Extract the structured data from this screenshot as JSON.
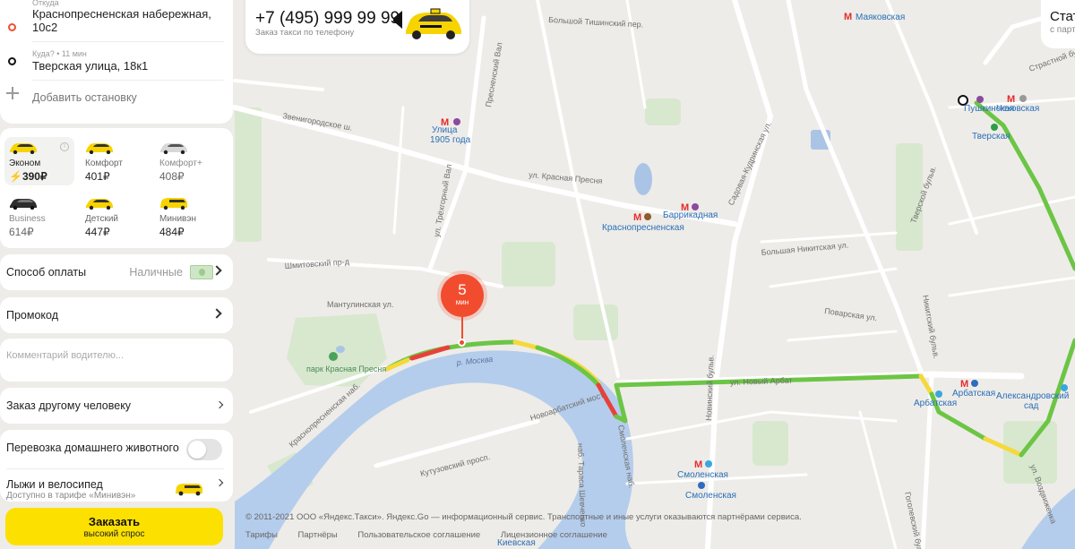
{
  "route": {
    "from_hint": "Откуда",
    "from_address_line1": "Краснопресненская набережная,",
    "from_address_line2": "10с2",
    "to_hint": "Куда? • 11 мин",
    "to_address": "Тверская улица, 18к1",
    "add_stop": "Добавить остановку"
  },
  "tariffs": [
    {
      "name": "Эконом",
      "price": "390₽",
      "surge": "⚡",
      "selected": true
    },
    {
      "name": "Комфорт",
      "price": "401₽",
      "selected": false
    },
    {
      "name": "Комфорт+",
      "price": "408₽",
      "selected": false
    },
    {
      "name": "Business",
      "price": "614₽",
      "selected": false
    },
    {
      "name": "Детский",
      "price": "447₽",
      "selected": false
    },
    {
      "name": "Минивэн",
      "price": "484₽",
      "selected": false
    }
  ],
  "options": {
    "payment_label": "Способ оплаты",
    "payment_value": "Наличные",
    "promo_label": "Промокод",
    "comment_placeholder": "Комментарий водителю...",
    "other_person_label": "Заказ другому человеку",
    "pet_label": "Перевозка домашнего животного",
    "ski_label": "Лыжи и велосипед",
    "ski_sub": "Доступно в тарифе «Минивэн»"
  },
  "order": {
    "label": "Заказать",
    "sub": "высокий спрос"
  },
  "phone_card": {
    "number": "+7 (495) 999 99 99",
    "subtitle": "Заказ такси по телефону"
  },
  "status_card": {
    "title": "Стат",
    "subtitle": "с парт"
  },
  "eta": {
    "value": "5",
    "unit": "мин"
  },
  "map": {
    "metro": [
      {
        "name": "Улица 1905 года",
        "line1": "Улица",
        "line2": "1905 года",
        "line": "7",
        "color": "#8a4a9e"
      },
      {
        "name": "Баррикадная",
        "line": "7",
        "color": "#8a4a9e"
      },
      {
        "name": "Краснопресненская",
        "line": "5",
        "color": "#8d5b2d"
      },
      {
        "name": "Маяковская",
        "line": "2",
        "color": "#2e9d4a"
      },
      {
        "name": "Пушкинская",
        "line": "7",
        "color": "#8a4a9e"
      },
      {
        "name": "Чеховская",
        "line": "9",
        "color": "#999999"
      },
      {
        "name": "Тверская",
        "line": "2",
        "color": "#2e9d4a"
      },
      {
        "name": "Арбатская",
        "line": "3",
        "color": "#2f6cc0"
      },
      {
        "name": "Арбатская",
        "line": "4",
        "color": "#3aa6e0"
      },
      {
        "name": "Александровский сад",
        "line1": "Александровский",
        "line2": "сад",
        "line": "4",
        "color": "#3aa6e0"
      },
      {
        "name": "Смоленская",
        "line": "4",
        "color": "#3aa6e0"
      },
      {
        "name": "Смоленская",
        "line": "3",
        "color": "#2f6cc0"
      },
      {
        "name": "Киевская",
        "line": "5",
        "color": "#8d5b2d"
      }
    ],
    "streets": [
      "Звенигородское ш.",
      "ул. Красная Пресня",
      "Шмитовский пр-д",
      "Мантулинская ул.",
      "Кутузовский просп.",
      "Новоарбатский мост",
      "ул. Новый Арбат",
      "Смоленская наб.",
      "наб. Тараса Шевченко",
      "Большая Никитская ул.",
      "Садовая-Кудринская ул.",
      "Тверской бульв.",
      "ул. Воздвиженка",
      "Новинский бульв.",
      "Краснопресненская наб.",
      "ул. Трёхгорный Вал",
      "Большой Тишинский пер.",
      "Пресненский Вал",
      "Никитский бульв.",
      "Поварская ул.",
      "Гоголевский бульв.",
      "Страстной бульв."
    ],
    "park": "парк Красная Пресня",
    "river": "р. Москва"
  },
  "footer": {
    "copyright": "© 2011-2021 ООО «Яндекс.Такси». Яндекс.Go — информационный сервис. Транспортные и иные услуги оказываются партнёрами сервиса.",
    "links": [
      "Тарифы",
      "Партнёры",
      "Пользовательское соглашение",
      "Лицензионное соглашение"
    ]
  },
  "colors": {
    "accent": "#fce000",
    "route_green": "#6cc545",
    "route_yellow": "#f5d93a",
    "route_red": "#e8413a",
    "eta_pin": "#f24c2e"
  }
}
